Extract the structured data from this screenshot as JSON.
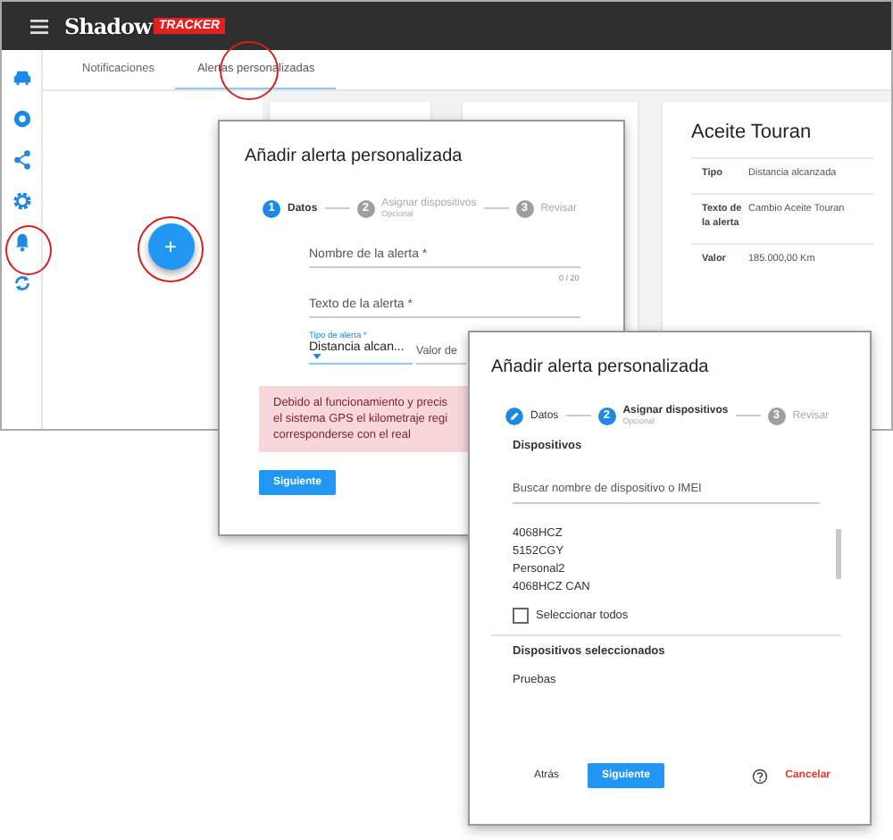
{
  "app": {
    "logo": {
      "name": "Shadow",
      "badge": "TRACKER"
    },
    "sidebar": [
      {
        "kind": "car"
      },
      {
        "kind": "target"
      },
      {
        "kind": "share"
      },
      {
        "kind": "gear"
      },
      {
        "kind": "bell"
      },
      {
        "kind": "sync"
      }
    ],
    "tabs": [
      {
        "label": "Notificaciones",
        "selected": false
      },
      {
        "label": "Alertas personalizadas",
        "selected": true
      }
    ],
    "card": {
      "title": "Aceite Touran",
      "rows": [
        {
          "label": "Tipo",
          "value": "Distancia alcanzada"
        },
        {
          "label": "Texto de la alerta",
          "value": "Cambio Aceite Touran"
        },
        {
          "label": "Valor",
          "value": "185.000,00 Km"
        }
      ]
    },
    "fab": "+"
  },
  "dialog_1": {
    "title": "Añadir alerta personalizada",
    "steps": [
      {
        "number": "1",
        "label": "Datos",
        "selected": true,
        "completed": false
      },
      {
        "number": "2",
        "label": "Asignar dispositivos",
        "note": "Opcional",
        "selected": false,
        "completed": false
      },
      {
        "number": "3",
        "label": "Revisar",
        "selected": false,
        "completed": false
      }
    ],
    "name_field": {
      "placeholder": "Nombre de la alerta *",
      "counter": "0 / 20"
    },
    "text_field": {
      "placeholder": "Texto de la alerta *"
    },
    "type_select": {
      "label": "Tipo de alerta *",
      "value": "Distancia alcan..."
    },
    "value_field": {
      "placeholder": "Valor de"
    },
    "warning": [
      "Debido al funcionamiento y precis",
      "el sistema GPS el kilometraje regi",
      "corresponderse con el real"
    ],
    "next_button": "Siguiente"
  },
  "dialog_2": {
    "title": "Añadir alerta personalizada",
    "steps": [
      {
        "label": "Datos",
        "selected": false,
        "completed": true
      },
      {
        "number": "2",
        "label": "Asignar dispositivos",
        "note": "Opcional",
        "selected": true,
        "completed": false
      },
      {
        "number": "3",
        "label": "Revisar",
        "selected": false,
        "completed": false
      }
    ],
    "devices_heading": "Dispositivos",
    "search": {
      "placeholder": "Buscar nombre de dispositivo o IMEI"
    },
    "devices": [
      "4068HCZ",
      "5152CGY",
      "Personal2",
      "4068HCZ CAN"
    ],
    "select_all": {
      "label": "Seleccionar todos",
      "checked": false
    },
    "selected_heading": "Dispositivos seleccionados",
    "selected_devices": [
      "Pruebas"
    ],
    "back_button": "Atrás",
    "next_button": "Siguiente",
    "cancel_button": "Cancelar"
  }
}
